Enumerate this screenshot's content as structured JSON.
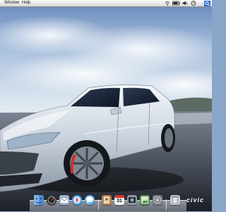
{
  "menubar": {
    "menus": [
      {
        "label": "Window"
      },
      {
        "label": "Help"
      }
    ],
    "status_icons": [
      "wifi-icon",
      "battery-icon",
      "volume-icon",
      "clock-icon",
      "spotlight-icon"
    ]
  },
  "desktop": {
    "wallpaper": "silver-sedan-on-road",
    "wallpaper_text": "civic"
  },
  "dock": {
    "apps": [
      {
        "name": "finder-icon",
        "color": "#4f8fd6"
      },
      {
        "name": "dashboard-icon",
        "color": "#2b2b2b"
      },
      {
        "name": "mail-icon",
        "color": "#9db1c9"
      },
      {
        "name": "safari-icon",
        "color": "#4aa6e8"
      },
      {
        "name": "ichat-icon",
        "color": "#69b3ef"
      },
      {
        "name": "address-book-icon",
        "color": "#b6864d"
      },
      {
        "name": "ical-icon",
        "color": "#f4f4f4",
        "day": "31"
      },
      {
        "name": "photo-booth-icon",
        "color": "#8f9aa6"
      },
      {
        "name": "preview-icon",
        "color": "#5c8f59"
      },
      {
        "name": "system-preferences-icon",
        "color": "#7b7f86"
      },
      {
        "name": "trash-icon",
        "color": "#c6ccd3"
      }
    ]
  },
  "colors": {
    "sky_top": "#bfd0e6",
    "sky_bottom": "#7d9cc5",
    "road": "#2a2e36",
    "car_body": "#dfe6ee"
  }
}
